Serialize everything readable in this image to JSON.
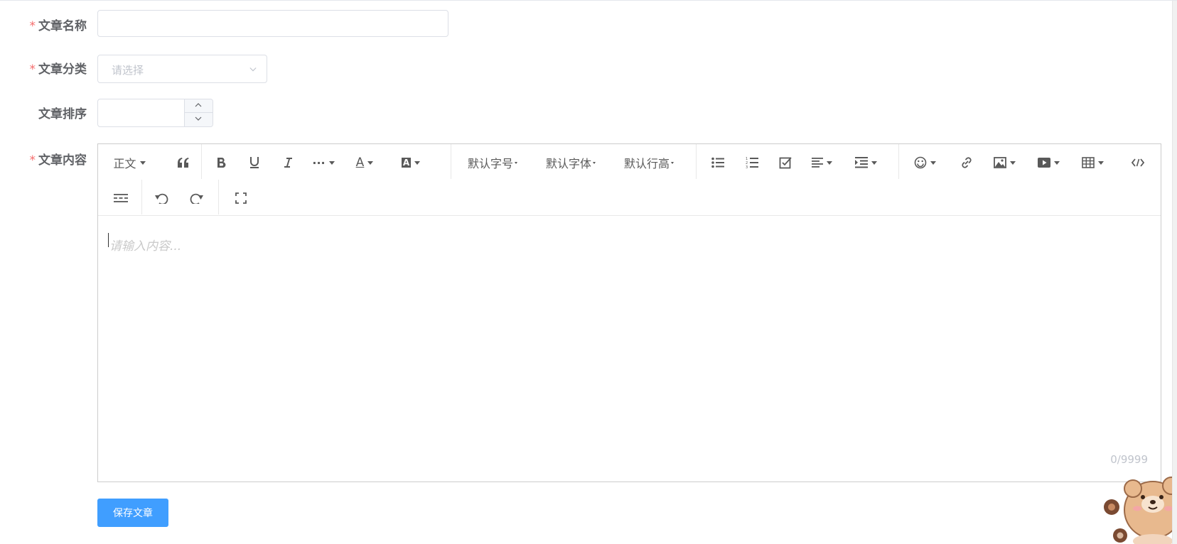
{
  "form": {
    "required_mark": "*",
    "title_label": "文章名称",
    "title_value": "",
    "category_label": "文章分类",
    "category_placeholder": "请选择",
    "order_label": "文章排序",
    "order_value": "",
    "content_label": "文章内容"
  },
  "toolbar": {
    "paragraph": "正文",
    "font_size": "默认字号",
    "font_family": "默认字体",
    "line_height": "默认行高",
    "more": "···",
    "font_color": "A",
    "bg_color": "A",
    "icons": [
      "quote-icon",
      "bold-icon",
      "underline-icon",
      "italic-icon",
      "more-icon",
      "font-color-icon",
      "bg-color-icon",
      "bulleted-list-icon",
      "numbered-list-icon",
      "todo-icon",
      "align-icon",
      "indent-icon",
      "emotion-icon",
      "link-icon",
      "image-icon",
      "video-icon",
      "table-icon",
      "code-block-icon",
      "divider-icon",
      "undo-icon",
      "redo-icon",
      "fullscreen-icon"
    ]
  },
  "editor": {
    "placeholder": "请输入内容...",
    "counter": "0/9999"
  },
  "actions": {
    "save_label": "保存文章"
  },
  "colors": {
    "primary": "#409eff",
    "required": "#f56c6c",
    "border": "#dcdfe6",
    "placeholder": "#c0c4cc"
  }
}
